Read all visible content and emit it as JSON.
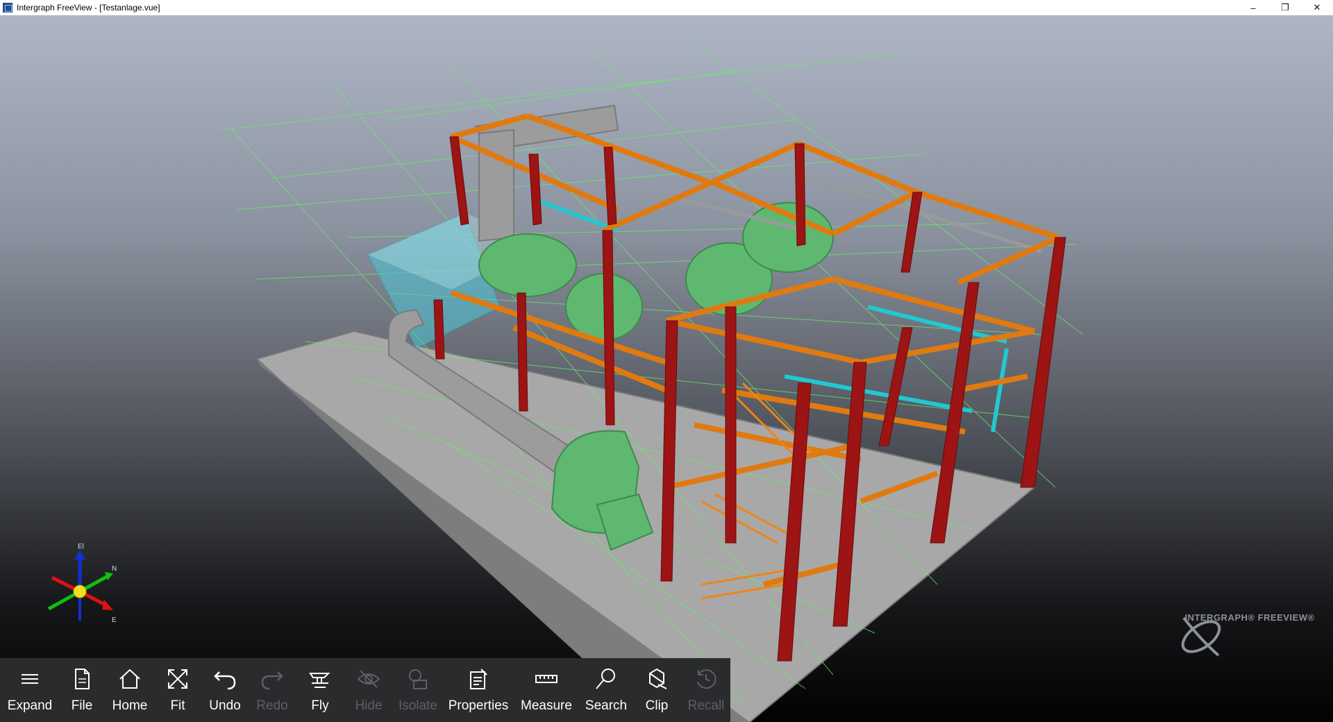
{
  "window": {
    "title": "Intergraph FreeView - [Testanlage.vue]",
    "minimize_glyph": "–",
    "restore_glyph": "❐",
    "close_glyph": "✕"
  },
  "axes": {
    "up_label": "El",
    "north_label": "N",
    "east_label": "E"
  },
  "toolbar": {
    "items": [
      {
        "label": "Expand",
        "icon": "hamburger-icon",
        "enabled": true
      },
      {
        "label": "File",
        "icon": "file-icon",
        "enabled": true
      },
      {
        "label": "Home",
        "icon": "home-icon",
        "enabled": true
      },
      {
        "label": "Fit",
        "icon": "fit-icon",
        "enabled": true
      },
      {
        "label": "Undo",
        "icon": "undo-icon",
        "enabled": true
      },
      {
        "label": "Redo",
        "icon": "redo-icon",
        "enabled": false
      },
      {
        "label": "Fly",
        "icon": "fly-icon",
        "enabled": true
      },
      {
        "label": "Hide",
        "icon": "hide-icon",
        "enabled": false
      },
      {
        "label": "Isolate",
        "icon": "isolate-icon",
        "enabled": false
      },
      {
        "label": "Properties",
        "icon": "properties-icon",
        "enabled": true
      },
      {
        "label": "Measure",
        "icon": "measure-icon",
        "enabled": true
      },
      {
        "label": "Search",
        "icon": "search-icon",
        "enabled": true
      },
      {
        "label": "Clip",
        "icon": "clip-icon",
        "enabled": true
      },
      {
        "label": "Recall",
        "icon": "recall-icon",
        "enabled": false
      }
    ]
  },
  "brand": {
    "text": "INTERGRAPH® FREEVIEW®"
  },
  "colors": {
    "steel_column": "#9c1414",
    "steel_beam": "#e07a10",
    "vessel": "#5fb870",
    "duct": "#9a9a9a",
    "pipe_cyan": "#22c8d0",
    "grid": "#66ee66",
    "floor": "#a6a6a6"
  }
}
